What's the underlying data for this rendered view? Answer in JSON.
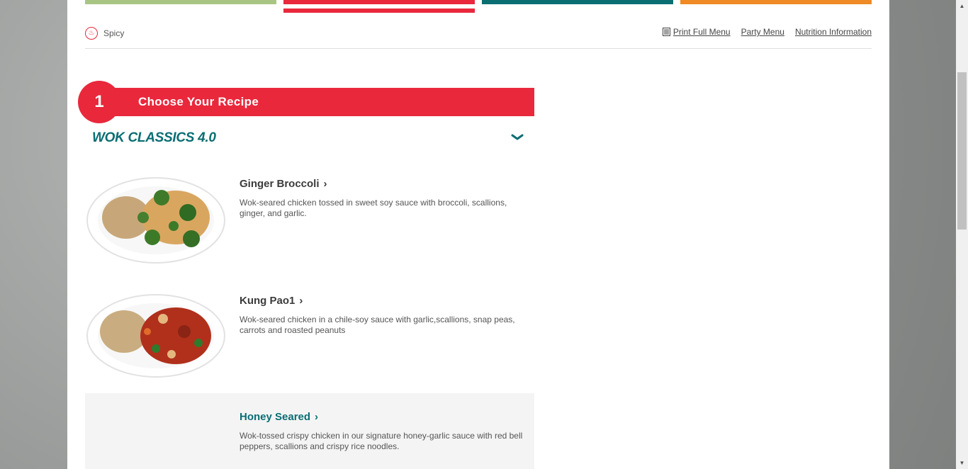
{
  "utility": {
    "spicy_label": "Spicy",
    "print_menu": "Print Full Menu",
    "party_menu": "Party Menu",
    "nutrition": "Nutrition Information"
  },
  "step": {
    "number": "1",
    "title": "Choose Your Recipe"
  },
  "category": {
    "title": "WOK CLASSICS 4.0"
  },
  "items": [
    {
      "name": "Ginger Broccoli",
      "description": "Wok-seared chicken tossed in sweet soy sauce with broccoli, scallions, ginger, and garlic."
    },
    {
      "name": "Kung Pao1",
      "description": "Wok-seared chicken in a chile-soy sauce with garlic,scallions, snap peas, carrots and roasted peanuts"
    },
    {
      "name": "Honey Seared",
      "description": "Wok-tossed crispy chicken in our signature honey-garlic sauce with red bell peppers, scallions and crispy rice noodles."
    }
  ],
  "colors": {
    "accent_red": "#e9283c",
    "accent_teal": "#0a6e73",
    "tab_green": "#a9c584",
    "tab_orange": "#ef8a24"
  }
}
